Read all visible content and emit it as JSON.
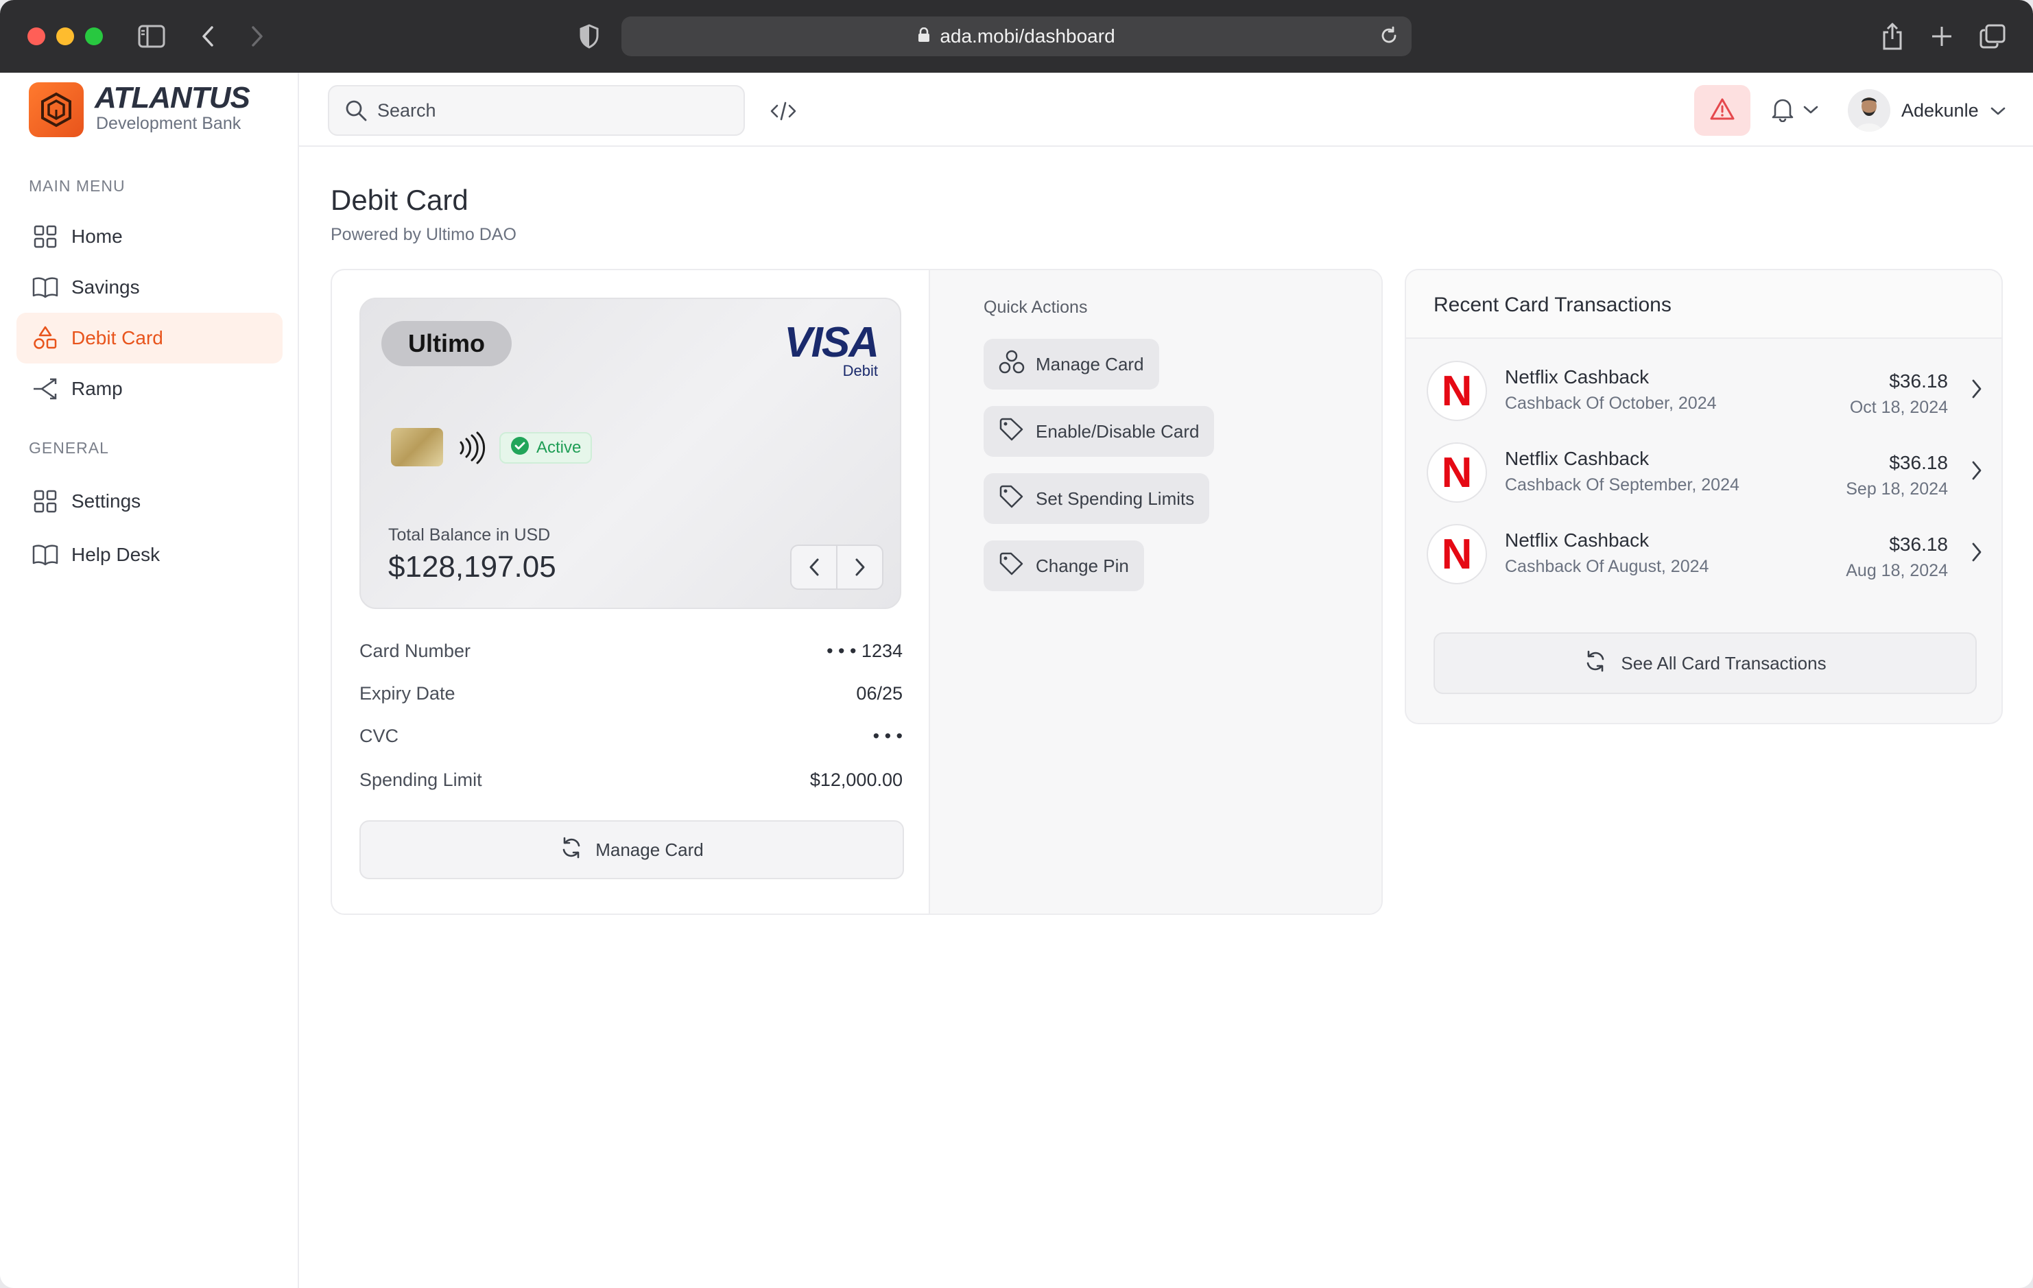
{
  "browser": {
    "url": "ada.mobi/dashboard"
  },
  "brand": {
    "title": "ATLANTUS",
    "subtitle": "Development Bank",
    "accent": "#e8541c"
  },
  "sidebar": {
    "main_menu_label": "MAIN MENU",
    "general_label": "GENERAL",
    "main_items": [
      {
        "label": "Home",
        "icon": "grid-icon"
      },
      {
        "label": "Savings",
        "icon": "book-icon"
      },
      {
        "label": "Debit Card",
        "icon": "shapes-icon",
        "active": true
      },
      {
        "label": "Ramp",
        "icon": "ramp-icon"
      }
    ],
    "general_items": [
      {
        "label": "Settings",
        "icon": "grid-icon"
      },
      {
        "label": "Help Desk",
        "icon": "book-icon"
      }
    ]
  },
  "topbar": {
    "search_placeholder": "Search",
    "user_name": "Adekunle"
  },
  "page": {
    "title": "Debit Card",
    "subtitle": "Powered by Ultimo DAO"
  },
  "card": {
    "issuer_logo": "Ultimo",
    "network": "VISA",
    "network_type": "Debit",
    "status": "Active",
    "balance_label": "Total Balance in USD",
    "balance": "$128,197.05"
  },
  "details": [
    {
      "label": "Card Number",
      "value": "• • •  1234"
    },
    {
      "label": "Expiry Date",
      "value": "06/25"
    },
    {
      "label": "CVC",
      "value": "• • •"
    },
    {
      "label": "Spending Limit",
      "value": "$12,000.00"
    }
  ],
  "manage_card_label": "Manage Card",
  "quick_actions": {
    "label": "Quick Actions",
    "items": [
      {
        "label": "Manage Card",
        "icon": "manage-icon"
      },
      {
        "label": "Enable/Disable Card",
        "icon": "tag-icon"
      },
      {
        "label": "Set Spending Limits",
        "icon": "tag-icon"
      },
      {
        "label": "Change Pin",
        "icon": "tag-icon"
      }
    ]
  },
  "transactions": {
    "title": "Recent Card Transactions",
    "items": [
      {
        "name": "Netflix Cashback",
        "desc": "Cashback Of October, 2024",
        "amount": "$36.18",
        "date": "Oct 18, 2024"
      },
      {
        "name": "Netflix Cashback",
        "desc": "Cashback Of September, 2024",
        "amount": "$36.18",
        "date": "Sep 18, 2024"
      },
      {
        "name": "Netflix Cashback",
        "desc": "Cashback Of August, 2024",
        "amount": "$36.18",
        "date": "Aug 18, 2024"
      }
    ],
    "see_all_label": "See All Card Transactions",
    "logo_letter": "N"
  }
}
